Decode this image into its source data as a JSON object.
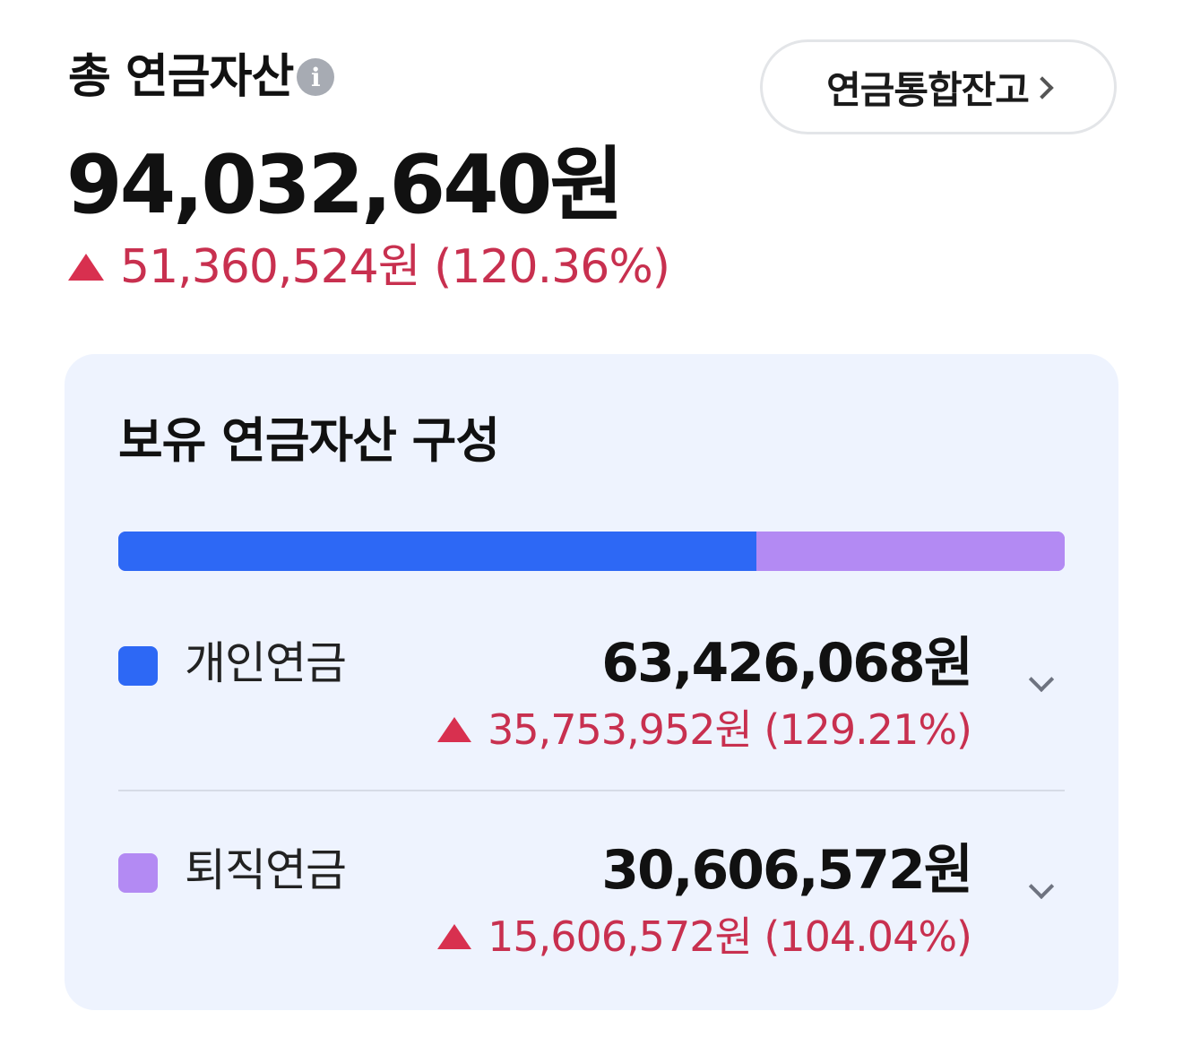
{
  "header": {
    "title": "총 연금자산",
    "info_icon": "info-icon",
    "balance_button_label": "연금통합잔고",
    "total_amount": "94,032,640원",
    "change_text": "51,360,524원 (120.36%)",
    "change_direction": "up"
  },
  "composition": {
    "title": "보유 연금자산 구성",
    "bar_colors": {
      "personal": "#2d68f5",
      "retirement": "#b38af3"
    },
    "shares": {
      "personal": 0.6745,
      "retirement": 0.3255
    },
    "items": [
      {
        "name": "개인연금",
        "amount": "63,426,068원",
        "change": "35,753,952원 (129.21%)",
        "color": "#2d68f5"
      },
      {
        "name": "퇴직연금",
        "amount": "30,606,572원",
        "change": "15,606,572원 (104.04%)",
        "color": "#b38af3"
      }
    ]
  },
  "colors": {
    "positive_change": "#c8304f",
    "card_background": "#eef3fe"
  }
}
